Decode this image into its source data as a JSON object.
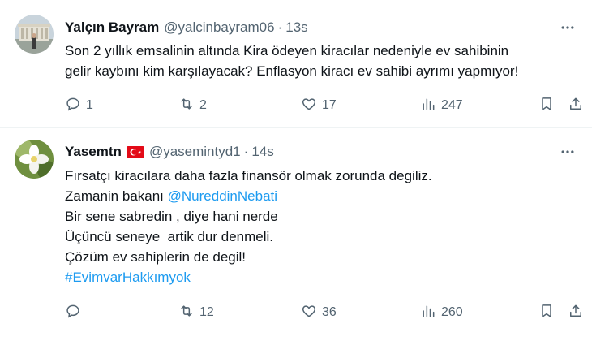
{
  "tweets": [
    {
      "author_name": "Yalçın Bayram",
      "handle": "@yalcinbayram06",
      "separator": "·",
      "time": "13s",
      "lines": [
        "Son 2 yıllık emsalinin altında Kira ödeyen kiracılar nedeniyle ev sahibinin",
        "gelir kaybını kim karşılayacak? Enflasyon kiracı ev sahibi ayrımı yapmıyor!"
      ],
      "replies": "1",
      "retweets": "2",
      "likes": "17",
      "views": "247"
    },
    {
      "author_name": "Yasemtn",
      "handle": "@yasemintyd1",
      "separator": "·",
      "time": "14s",
      "line1": "Fırsatçı kiracılara daha fazla finansör olmak zorunda degiliz.",
      "line2_prefix": "Zamanin bakanı ",
      "mention": "@NureddinNebati",
      "line3": "Bir sene sabredin , diye hani nerde",
      "line4": "Üçüncü seneye  artik dur denmeli.",
      "line5": "Çözüm ev sahiplerin de degil!",
      "hashtag": "#EvimvarHakkımyok",
      "replies": "",
      "retweets": "12",
      "likes": "36",
      "views": "260"
    }
  ],
  "icons": {
    "reply": "reply-icon",
    "retweet": "retweet-icon",
    "like": "heart-icon",
    "views": "views-icon",
    "bookmark": "bookmark-icon",
    "share": "share-icon",
    "more": "more-icon",
    "flag": "turkey-flag-icon"
  },
  "colors": {
    "text": "#0f1419",
    "secondary": "#536471",
    "link": "#1d9bf0",
    "divider": "#eff3f4",
    "flag": "#e30a17"
  }
}
